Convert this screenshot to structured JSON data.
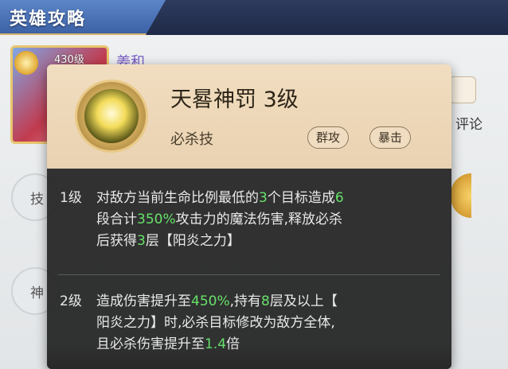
{
  "header": {
    "title": "英雄攻略"
  },
  "hero": {
    "level": "430级",
    "name": "姜和"
  },
  "side": {
    "comment_label": "评论"
  },
  "left_labels": [
    "技",
    "神"
  ],
  "popup": {
    "skill_name": "天晷神罚 3级",
    "skill_type": "必杀技",
    "tags": [
      "群攻",
      "暴击"
    ],
    "levels": [
      {
        "label": "1级",
        "lines": [
          [
            {
              "t": "对敌方当前生命比例最低的"
            },
            {
              "t": "3",
              "hl": true
            },
            {
              "t": "个目标造成"
            },
            {
              "t": "6",
              "hl": true
            }
          ],
          [
            {
              "t": "段合计"
            },
            {
              "t": "350%",
              "hl": true
            },
            {
              "t": "攻击力的魔法伤害,释放必杀"
            }
          ],
          [
            {
              "t": "后获得"
            },
            {
              "t": "3",
              "hl": true
            },
            {
              "t": "层【阳炎之力】"
            }
          ]
        ]
      },
      {
        "label": "2级",
        "lines": [
          [
            {
              "t": "造成伤害提升至"
            },
            {
              "t": "450%",
              "hl": true
            },
            {
              "t": ",持有"
            },
            {
              "t": "8",
              "hl": true
            },
            {
              "t": "层及以上【"
            }
          ],
          [
            {
              "t": "阳炎之力】时,必杀目标修改为敌方全体,"
            }
          ],
          [
            {
              "t": "且必杀伤害提升至"
            },
            {
              "t": "1.4",
              "hl": true
            },
            {
              "t": "倍"
            }
          ]
        ]
      }
    ]
  },
  "colors": {
    "highlight": "#67e26a",
    "body_bg": "#222222",
    "head_bg": "#ecd6b6",
    "title_tab": "#4a72b8"
  }
}
